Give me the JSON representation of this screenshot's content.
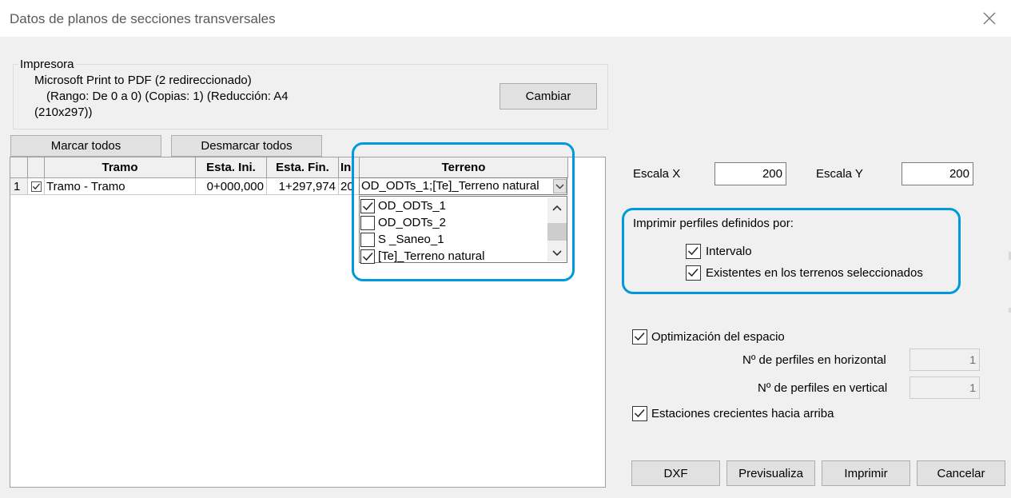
{
  "window": {
    "title": "Datos de planos de secciones transversales"
  },
  "printer": {
    "legend": "Impresora",
    "line1": "Microsoft Print to PDF (2 redireccionado)",
    "line2": "(Rango: De 0 a 0) (Copias: 1) (Reducción: A4",
    "line3": "(210x297))",
    "change_label": "Cambiar"
  },
  "toolbar": {
    "mark_all": "Marcar todos",
    "unmark_all": "Desmarcar todos"
  },
  "grid": {
    "headers": [
      "Tramo",
      "Esta. Ini.",
      "Esta. Fin.",
      "In",
      "Terreno"
    ],
    "rows": [
      {
        "num": "1",
        "tramo": "Tramo - Tramo",
        "ini": "0+000,000",
        "fin": "1+297,974",
        "in": "20",
        "terreno": "OD_ODTs_1;[Te]_Terreno natural"
      }
    ]
  },
  "terrain_list": [
    {
      "label": "OD_ODTs_1",
      "checked": true
    },
    {
      "label": "OD_ODTs_2",
      "checked": false
    },
    {
      "label": "S _Saneo_1",
      "checked": false
    },
    {
      "label": "[Te]_Terreno natural",
      "checked": true
    }
  ],
  "scale": {
    "x_label": "Escala X",
    "x_value": "200",
    "y_label": "Escala Y",
    "y_value": "200"
  },
  "profiles": {
    "heading": "Imprimir perfiles definidos por:",
    "interval_label": "Intervalo",
    "existing_label": "Existentes en los terrenos seleccionados"
  },
  "options": {
    "optimize_label": "Optimización del espacio",
    "horizontal_label": "Nº de perfiles en horizontal",
    "horizontal_value": "1",
    "vertical_label": "Nº de perfiles en vertical",
    "vertical_value": "1",
    "ascending_label": "Estaciones crecientes hacia arriba"
  },
  "buttons": {
    "dxf": "DXF",
    "preview": "Previsualiza",
    "print": "Imprimir",
    "cancel": "Cancelar"
  },
  "colors": {
    "highlight": "#0099dd"
  }
}
